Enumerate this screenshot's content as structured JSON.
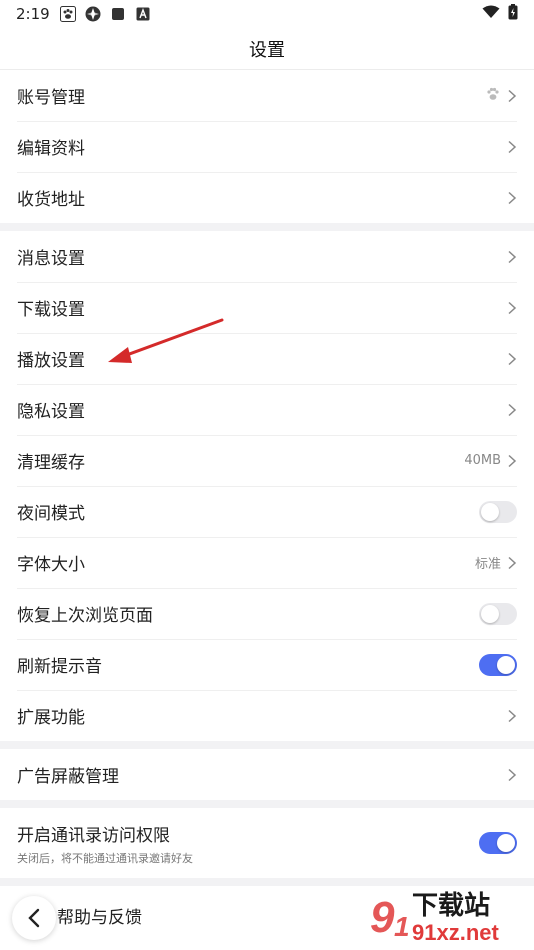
{
  "status": {
    "time": "2:19",
    "icons": [
      "paw-icon",
      "pinwheel-icon",
      "square-icon",
      "a-box-icon"
    ],
    "right_icons": [
      "wifi-icon",
      "battery-icon"
    ]
  },
  "header": {
    "title": "设置"
  },
  "groups": [
    [
      {
        "label": "账号管理",
        "value": "",
        "icon": "paw-icon",
        "type": "link"
      },
      {
        "label": "编辑资料",
        "type": "link"
      },
      {
        "label": "收货地址",
        "type": "link"
      }
    ],
    [
      {
        "label": "消息设置",
        "type": "link"
      },
      {
        "label": "下载设置",
        "type": "link"
      },
      {
        "label": "播放设置",
        "type": "link"
      },
      {
        "label": "隐私设置",
        "type": "link"
      },
      {
        "label": "清理缓存",
        "value": "40MB",
        "type": "link"
      },
      {
        "label": "夜间模式",
        "type": "toggle",
        "on": false
      },
      {
        "label": "字体大小",
        "value": "标准",
        "type": "link"
      },
      {
        "label": "恢复上次浏览页面",
        "type": "toggle",
        "on": false
      },
      {
        "label": "刷新提示音",
        "type": "toggle",
        "on": true
      },
      {
        "label": "扩展功能",
        "type": "link"
      }
    ],
    [
      {
        "label": "广告屏蔽管理",
        "type": "link"
      }
    ]
  ],
  "contacts": {
    "label": "开启通讯录访问权限",
    "sub": "关闭后，将不能通过通讯录邀请好友",
    "on": true
  },
  "bottom": {
    "label": "帮助与反馈"
  },
  "watermark": {
    "text_top": "下载站",
    "text_bottom": "91xz.net"
  },
  "colors": {
    "accent": "#4e6ef2",
    "arrow": "#d42a2a",
    "watermark": "#e03a3a"
  }
}
